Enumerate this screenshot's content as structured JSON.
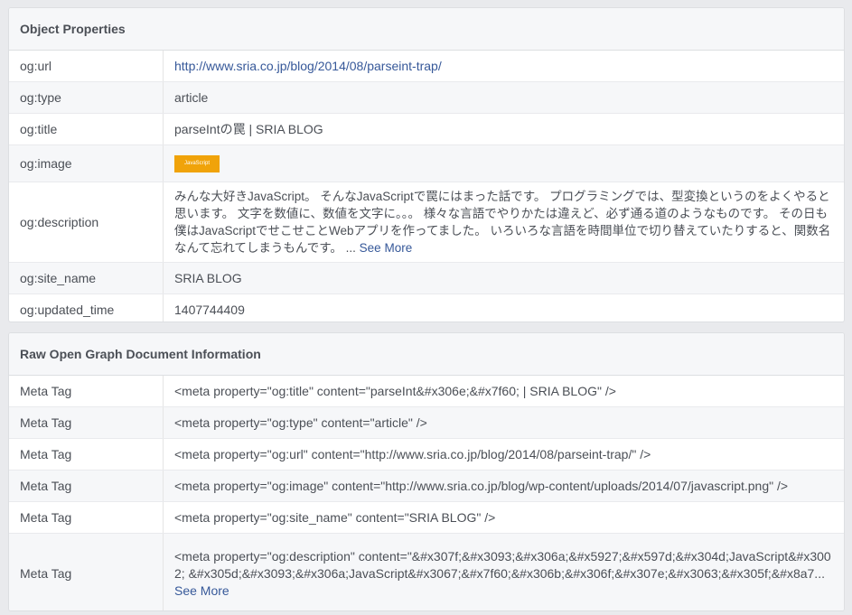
{
  "object_properties": {
    "title": "Object Properties",
    "rows": [
      {
        "key": "og:url",
        "value": "http://www.sria.co.jp/blog/2014/08/parseint-trap/"
      },
      {
        "key": "og:type",
        "value": "article"
      },
      {
        "key": "og:title",
        "value": "parseIntの罠 | SRIA BLOG"
      },
      {
        "key": "og:image",
        "image_label": "JavaScript"
      },
      {
        "key": "og:description",
        "value": "みんな大好きJavaScript。 そんなJavaScriptで罠にはまった話です。 プログラミングでは、型変換というのをよくやると思います。 文字を数値に、数値を文字に。。。 様々な言語でやりかたは違えど、必ず通る道のようなものです。 その日も僕はJavaScriptでせこせことWebアプリを作ってました。 いろいろな言語を時間単位で切り替えていたりすると、関数名なんて忘れてしまうもんです。 ...",
        "see_more": "See More"
      },
      {
        "key": "og:site_name",
        "value": "SRIA BLOG"
      },
      {
        "key": "og:updated_time",
        "value": "1407744409"
      }
    ]
  },
  "raw_info": {
    "title": "Raw Open Graph Document Information",
    "rows": [
      {
        "key": "Meta Tag",
        "value": "<meta property=\"og:title\" content=\"parseInt&#x306e;&#x7f60; | SRIA BLOG\" />"
      },
      {
        "key": "Meta Tag",
        "value": "<meta property=\"og:type\" content=\"article\" />"
      },
      {
        "key": "Meta Tag",
        "value": "<meta property=\"og:url\" content=\"http://www.sria.co.jp/blog/2014/08/parseint-trap/\" />"
      },
      {
        "key": "Meta Tag",
        "value": "<meta property=\"og:image\" content=\"http://www.sria.co.jp/blog/wp-content/uploads/2014/07/javascript.png\" />"
      },
      {
        "key": "Meta Tag",
        "value": "<meta property=\"og:site_name\" content=\"SRIA BLOG\" />"
      },
      {
        "key": "Meta Tag",
        "value": "<meta property=\"og:description\" content=\"&#x307f;&#x3093;&#x306a;&#x5927;&#x597d;&#x304d;JavaScript&#x3002; &#x305d;&#x3093;&#x306a;JavaScript&#x3067;&#x7f60;&#x306b;&#x306f;&#x307e;&#x3063;&#x305f;&#x8a7...",
        "see_more": "See More"
      }
    ]
  },
  "colors": {
    "link": "#365899",
    "thumbnail": "#f0a30a"
  }
}
